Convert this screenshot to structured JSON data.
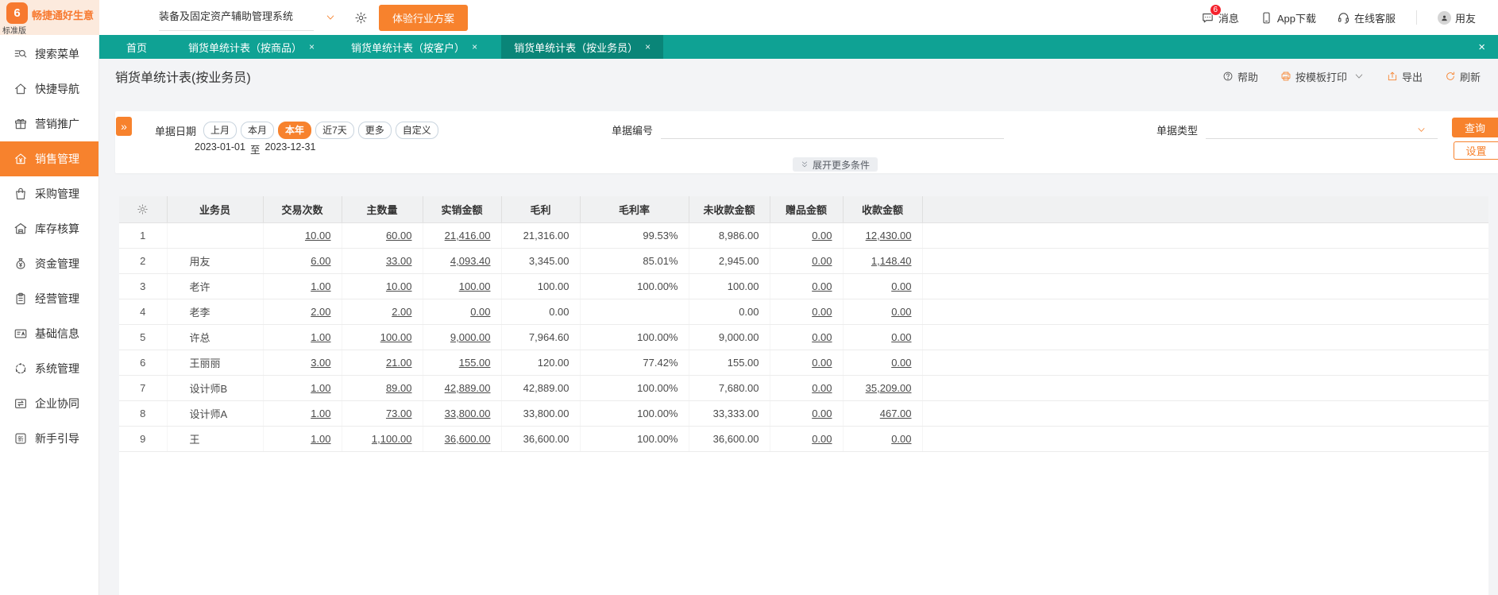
{
  "colors": {
    "accent": "#f7822d",
    "tabbar": "#0fa294",
    "tabbar_active": "#0a8578",
    "badge": "#f5222d",
    "logo_bg": "#fceadd"
  },
  "glyphs": {
    "close": "×",
    "collapse": "»"
  },
  "topbar": {
    "logo_mark": "6",
    "logo_title": "畅捷通好生意",
    "logo_subtitle": "标准版",
    "system_select": "装备及固定资产辅助管理系统",
    "trial_button": "体验行业方案",
    "messages": {
      "label": "消息",
      "badge": "6"
    },
    "app_download": "App下载",
    "online_service": "在线客服",
    "username": "用友"
  },
  "sidebar": {
    "active_index": 3,
    "items": [
      {
        "label": "搜索菜单",
        "icon": "search-icon"
      },
      {
        "label": "快捷导航",
        "icon": "home-icon"
      },
      {
        "label": "营销推广",
        "icon": "gift-icon"
      },
      {
        "label": "销售管理",
        "icon": "sales-icon"
      },
      {
        "label": "采购管理",
        "icon": "bag-icon"
      },
      {
        "label": "库存核算",
        "icon": "warehouse-icon"
      },
      {
        "label": "资金管理",
        "icon": "moneybag-icon"
      },
      {
        "label": "经营管理",
        "icon": "clipboard-icon"
      },
      {
        "label": "基础信息",
        "icon": "idcard-icon"
      },
      {
        "label": "系统管理",
        "icon": "system-icon"
      },
      {
        "label": "企业协同",
        "icon": "collab-icon"
      },
      {
        "label": "新手引导",
        "icon": "newbie-icon"
      }
    ]
  },
  "tabs": {
    "active_index": 3,
    "items": [
      {
        "label": "首页",
        "closable": false
      },
      {
        "label": "销货单统计表（按商品）",
        "closable": true
      },
      {
        "label": "销货单统计表（按客户）",
        "closable": true
      },
      {
        "label": "销货单统计表（按业务员）",
        "closable": true
      }
    ]
  },
  "page": {
    "title": "销货单统计表(按业务员)",
    "toolbar": {
      "help": "帮助",
      "print": "按模板打印",
      "export": "导出",
      "refresh": "刷新"
    }
  },
  "filters": {
    "date_label": "单据日期",
    "date_presets": [
      "上月",
      "本月",
      "本年",
      "近7天",
      "更多",
      "自定义"
    ],
    "active_preset_index": 2,
    "date_from": "2023-01-01",
    "date_separator": "至",
    "date_to": "2023-12-31",
    "doc_no_label": "单据编号",
    "doc_no_value": "",
    "doc_type_label": "单据类型",
    "doc_type_value": "",
    "search_button": "查询",
    "settings_button": "设置",
    "expand_more": "展开更多条件"
  },
  "table": {
    "columns": [
      "业务员",
      "交易次数",
      "主数量",
      "实销金额",
      "毛利",
      "毛利率",
      "未收款金额",
      "赠品金额",
      "收款金额"
    ],
    "link_value_indexes": [
      0,
      1,
      2,
      6,
      7
    ],
    "rows": [
      {
        "no": "1",
        "name": "",
        "values": [
          "10.00",
          "60.00",
          "21,416.00",
          "21,316.00",
          "99.53%",
          "8,986.00",
          "0.00",
          "12,430.00"
        ]
      },
      {
        "no": "2",
        "name": "用友",
        "values": [
          "6.00",
          "33.00",
          "4,093.40",
          "3,345.00",
          "85.01%",
          "2,945.00",
          "0.00",
          "1,148.40"
        ]
      },
      {
        "no": "3",
        "name": "老许",
        "values": [
          "1.00",
          "10.00",
          "100.00",
          "100.00",
          "100.00%",
          "100.00",
          "0.00",
          "0.00"
        ]
      },
      {
        "no": "4",
        "name": "老李",
        "values": [
          "2.00",
          "2.00",
          "0.00",
          "0.00",
          "",
          "0.00",
          "0.00",
          "0.00"
        ]
      },
      {
        "no": "5",
        "name": "许总",
        "values": [
          "1.00",
          "100.00",
          "9,000.00",
          "7,964.60",
          "100.00%",
          "9,000.00",
          "0.00",
          "0.00"
        ]
      },
      {
        "no": "6",
        "name": "王丽丽",
        "values": [
          "3.00",
          "21.00",
          "155.00",
          "120.00",
          "77.42%",
          "155.00",
          "0.00",
          "0.00"
        ]
      },
      {
        "no": "7",
        "name": "设计师B",
        "values": [
          "1.00",
          "89.00",
          "42,889.00",
          "42,889.00",
          "100.00%",
          "7,680.00",
          "0.00",
          "35,209.00"
        ]
      },
      {
        "no": "8",
        "name": "设计师A",
        "values": [
          "1.00",
          "73.00",
          "33,800.00",
          "33,800.00",
          "100.00%",
          "33,333.00",
          "0.00",
          "467.00"
        ]
      },
      {
        "no": "9",
        "name": "王",
        "values": [
          "1.00",
          "1,100.00",
          "36,600.00",
          "36,600.00",
          "100.00%",
          "36,600.00",
          "0.00",
          "0.00"
        ]
      }
    ]
  }
}
